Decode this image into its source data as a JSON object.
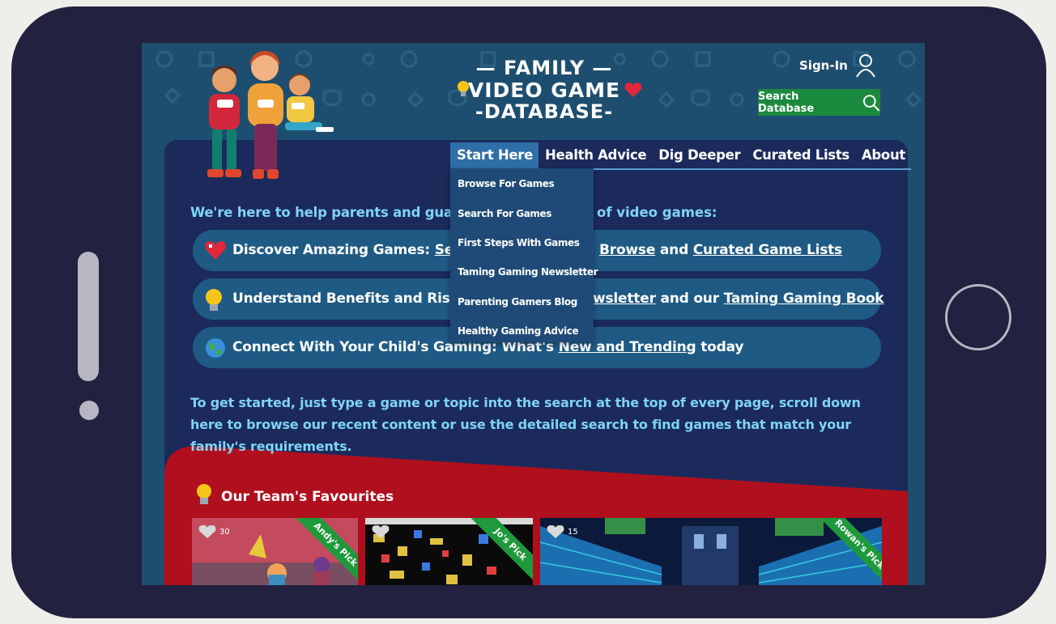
{
  "site": {
    "logo_line1": "— FAMILY —",
    "logo_line2": "VIDEO GAME",
    "logo_line3": "-DATABASE-",
    "signin_label": "Sign-In",
    "search_label": "Search Database"
  },
  "nav": {
    "items": [
      {
        "label": "Start Here"
      },
      {
        "label": "Health Advice"
      },
      {
        "label": "Dig Deeper"
      },
      {
        "label": "Curated Lists"
      },
      {
        "label": "About"
      }
    ],
    "dropdown": [
      {
        "label": "Browse For Games"
      },
      {
        "label": "Search For Games"
      },
      {
        "label": "First Steps With Games"
      },
      {
        "label": "Taming Gaming Newsletter"
      },
      {
        "label": "Parenting Gamers Blog"
      },
      {
        "label": "Healthy Gaming Advice"
      }
    ]
  },
  "intro": {
    "text_start": "We're here to help parents and guardian",
    "text_end": "of video games:"
  },
  "pills": [
    {
      "label": "Discover Amazing Games:",
      "link1": "Searc",
      "link2": "Browse",
      "mid": "and",
      "link3": "Curated Game Lists"
    },
    {
      "label": "Understand Benefits and Risks:",
      "link1": "Pa",
      "link2": "wsletter",
      "mid": "and our",
      "link3": "Taming Gaming Book"
    },
    {
      "label": "Connect With Your Child's Gaming:",
      "pre": "What's",
      "link1": "New and Trending",
      "post": "today"
    }
  ],
  "paragraph": "To get started, just type a game or topic into the search at the top of every page, scroll down here to browse our recent content or use the detailed search to find games that match your family's requirements.",
  "favourites": {
    "title": "Our Team's Favourites",
    "cards": [
      {
        "pick": "Andy's Pick",
        "likes": "30"
      },
      {
        "pick": "Jo's Pick",
        "likes": ""
      },
      {
        "pick": "Rowan's Pick",
        "likes": "15"
      }
    ]
  },
  "colors": {
    "device": "#22213f",
    "page_bg": "#1e4e6f",
    "panel": "#1b2a5a",
    "accent_cyan": "#7fd3f7",
    "search_green": "#1b8a3f",
    "favourites_red": "#b0101e"
  },
  "icons": {
    "signin": "user-icon",
    "search": "magnifier-icon",
    "pill1": "heart-icon",
    "pill2": "lightbulb-icon",
    "pill3": "globe-icon"
  }
}
